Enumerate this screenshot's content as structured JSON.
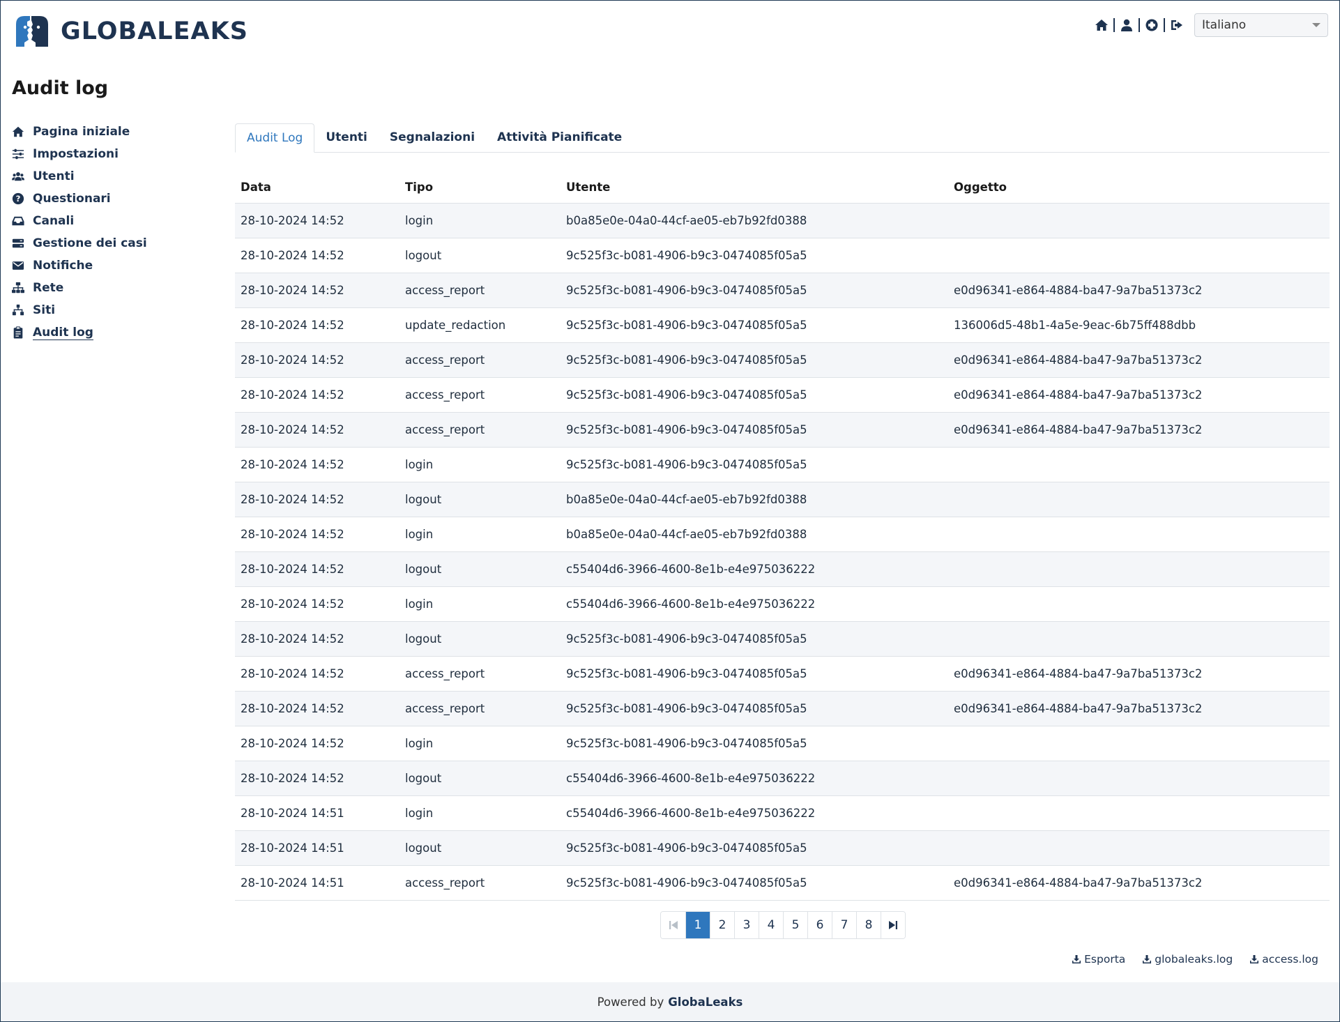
{
  "header": {
    "logo_text": "GLOBALEAKS",
    "icons": [
      "home-icon",
      "user-icon",
      "help-icon",
      "logout-icon"
    ],
    "language": "Italiano"
  },
  "page_title": "Audit log",
  "sidebar": {
    "items": [
      {
        "label": "Pagina iniziale",
        "icon": "home-icon"
      },
      {
        "label": "Impostazioni",
        "icon": "sliders-icon"
      },
      {
        "label": "Utenti",
        "icon": "users-icon"
      },
      {
        "label": "Questionari",
        "icon": "question-icon"
      },
      {
        "label": "Canali",
        "icon": "inbox-icon"
      },
      {
        "label": "Gestione dei casi",
        "icon": "server-icon"
      },
      {
        "label": "Notifiche",
        "icon": "envelope-icon"
      },
      {
        "label": "Rete",
        "icon": "network-icon"
      },
      {
        "label": "Siti",
        "icon": "sitemap-icon"
      },
      {
        "label": "Audit log",
        "icon": "clipboard-icon"
      }
    ]
  },
  "tabs": [
    "Audit Log",
    "Utenti",
    "Segnalazioni",
    "Attività Pianificate"
  ],
  "table": {
    "columns": [
      "Data",
      "Tipo",
      "Utente",
      "Oggetto"
    ],
    "rows": [
      [
        "28-10-2024 14:52",
        "login",
        "b0a85e0e-04a0-44cf-ae05-eb7b92fd0388",
        ""
      ],
      [
        "28-10-2024 14:52",
        "logout",
        "9c525f3c-b081-4906-b9c3-0474085f05a5",
        ""
      ],
      [
        "28-10-2024 14:52",
        "access_report",
        "9c525f3c-b081-4906-b9c3-0474085f05a5",
        "e0d96341-e864-4884-ba47-9a7ba51373c2"
      ],
      [
        "28-10-2024 14:52",
        "update_redaction",
        "9c525f3c-b081-4906-b9c3-0474085f05a5",
        "136006d5-48b1-4a5e-9eac-6b75ff488dbb"
      ],
      [
        "28-10-2024 14:52",
        "access_report",
        "9c525f3c-b081-4906-b9c3-0474085f05a5",
        "e0d96341-e864-4884-ba47-9a7ba51373c2"
      ],
      [
        "28-10-2024 14:52",
        "access_report",
        "9c525f3c-b081-4906-b9c3-0474085f05a5",
        "e0d96341-e864-4884-ba47-9a7ba51373c2"
      ],
      [
        "28-10-2024 14:52",
        "access_report",
        "9c525f3c-b081-4906-b9c3-0474085f05a5",
        "e0d96341-e864-4884-ba47-9a7ba51373c2"
      ],
      [
        "28-10-2024 14:52",
        "login",
        "9c525f3c-b081-4906-b9c3-0474085f05a5",
        ""
      ],
      [
        "28-10-2024 14:52",
        "logout",
        "b0a85e0e-04a0-44cf-ae05-eb7b92fd0388",
        ""
      ],
      [
        "28-10-2024 14:52",
        "login",
        "b0a85e0e-04a0-44cf-ae05-eb7b92fd0388",
        ""
      ],
      [
        "28-10-2024 14:52",
        "logout",
        "c55404d6-3966-4600-8e1b-e4e975036222",
        ""
      ],
      [
        "28-10-2024 14:52",
        "login",
        "c55404d6-3966-4600-8e1b-e4e975036222",
        ""
      ],
      [
        "28-10-2024 14:52",
        "logout",
        "9c525f3c-b081-4906-b9c3-0474085f05a5",
        ""
      ],
      [
        "28-10-2024 14:52",
        "access_report",
        "9c525f3c-b081-4906-b9c3-0474085f05a5",
        "e0d96341-e864-4884-ba47-9a7ba51373c2"
      ],
      [
        "28-10-2024 14:52",
        "access_report",
        "9c525f3c-b081-4906-b9c3-0474085f05a5",
        "e0d96341-e864-4884-ba47-9a7ba51373c2"
      ],
      [
        "28-10-2024 14:52",
        "login",
        "9c525f3c-b081-4906-b9c3-0474085f05a5",
        ""
      ],
      [
        "28-10-2024 14:52",
        "logout",
        "c55404d6-3966-4600-8e1b-e4e975036222",
        ""
      ],
      [
        "28-10-2024 14:51",
        "login",
        "c55404d6-3966-4600-8e1b-e4e975036222",
        ""
      ],
      [
        "28-10-2024 14:51",
        "logout",
        "9c525f3c-b081-4906-b9c3-0474085f05a5",
        ""
      ],
      [
        "28-10-2024 14:51",
        "access_report",
        "9c525f3c-b081-4906-b9c3-0474085f05a5",
        "e0d96341-e864-4884-ba47-9a7ba51373c2"
      ]
    ]
  },
  "pagination": {
    "pages": [
      "1",
      "2",
      "3",
      "4",
      "5",
      "6",
      "7",
      "8"
    ],
    "current": "1",
    "first_icon": "first-page-icon",
    "last_icon": "last-page-icon"
  },
  "downloads": [
    {
      "label": "Esporta",
      "icon": "download-icon"
    },
    {
      "label": "globaleaks.log",
      "icon": "download-icon"
    },
    {
      "label": "access.log",
      "icon": "download-icon"
    }
  ],
  "footer": {
    "prefix": "Powered by",
    "brand": "GlobaLeaks"
  },
  "colors": {
    "brand_dark": "#1e3350",
    "accent": "#2f77bd",
    "row_stripe": "#f4f6f9"
  }
}
